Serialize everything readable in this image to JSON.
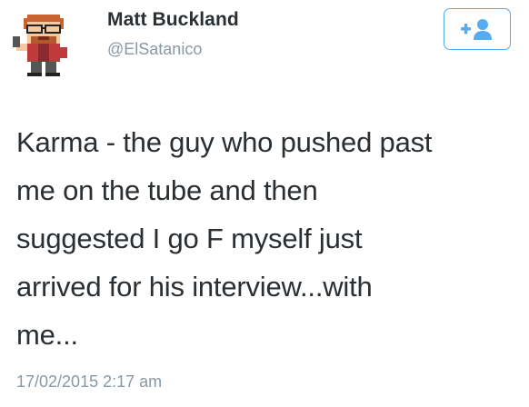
{
  "user": {
    "display_name": "Matt Buckland",
    "handle": "@ElSatanico",
    "avatar_icon": "pixel-art-avatar"
  },
  "follow_button": {
    "icon": "follow-user-icon",
    "color": "#55acee"
  },
  "tweet": {
    "text_lines": [
      "Karma - the guy who pushed past",
      "me on the tube and then",
      "suggested I go F myself just",
      "arrived for his interview...with",
      "me..."
    ],
    "timestamp": "17/02/2015 2:17 am"
  },
  "colors": {
    "text": "#292f33",
    "muted": "#8899a6",
    "accent": "#55acee"
  }
}
